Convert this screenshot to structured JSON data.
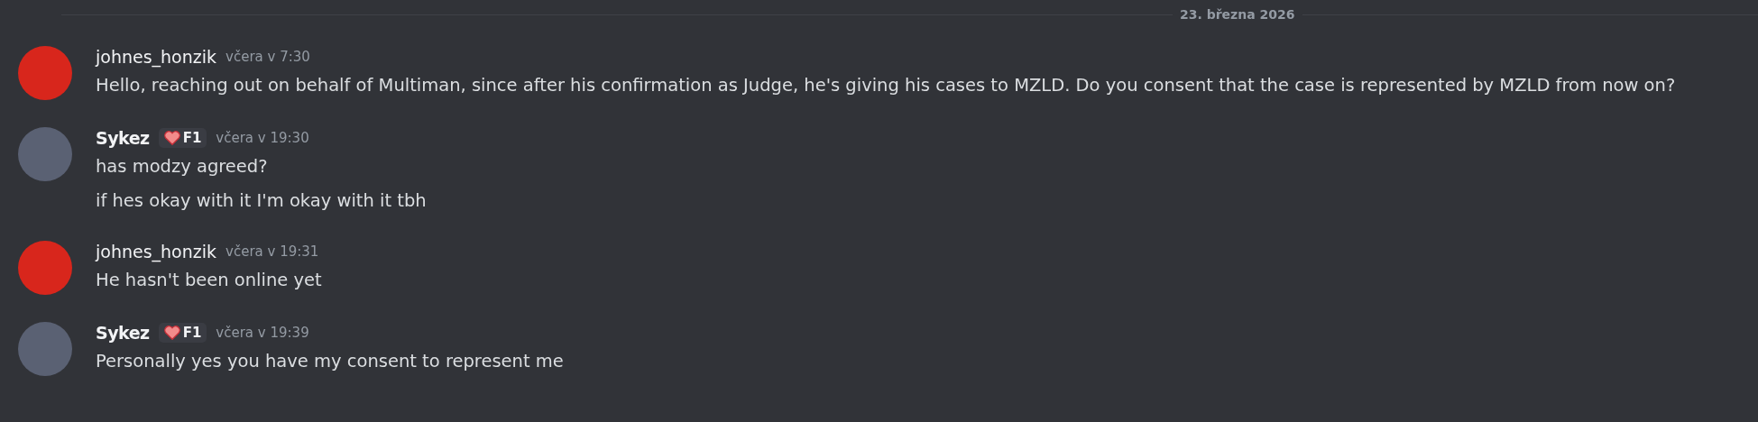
{
  "date_divider": "23. března 2026",
  "messages": [
    {
      "author": "johnes_honzik",
      "kind": "plain",
      "color": "#d8261c",
      "time": "včera v 7:30",
      "lines": [
        "Hello, reaching out on behalf of Multiman, since after his confirmation as Judge, he's giving his cases to MZLD. Do you consent that the case is represented by MZLD from now on?"
      ]
    },
    {
      "author": "Sykez",
      "kind": "display",
      "color": "#5a6173",
      "badge": "F1",
      "time": "včera v 19:30",
      "lines": [
        "has modzy agreed?",
        "if hes okay with it I'm okay with it tbh"
      ]
    },
    {
      "author": "johnes_honzik",
      "kind": "plain",
      "color": "#d8261c",
      "time": "včera v 19:31",
      "lines": [
        "He hasn't been online yet"
      ]
    },
    {
      "author": "Sykez",
      "kind": "display",
      "color": "#5a6173",
      "badge": "F1",
      "time": "včera v 19:39",
      "lines": [
        "Personally yes you have my consent to represent me"
      ]
    }
  ]
}
